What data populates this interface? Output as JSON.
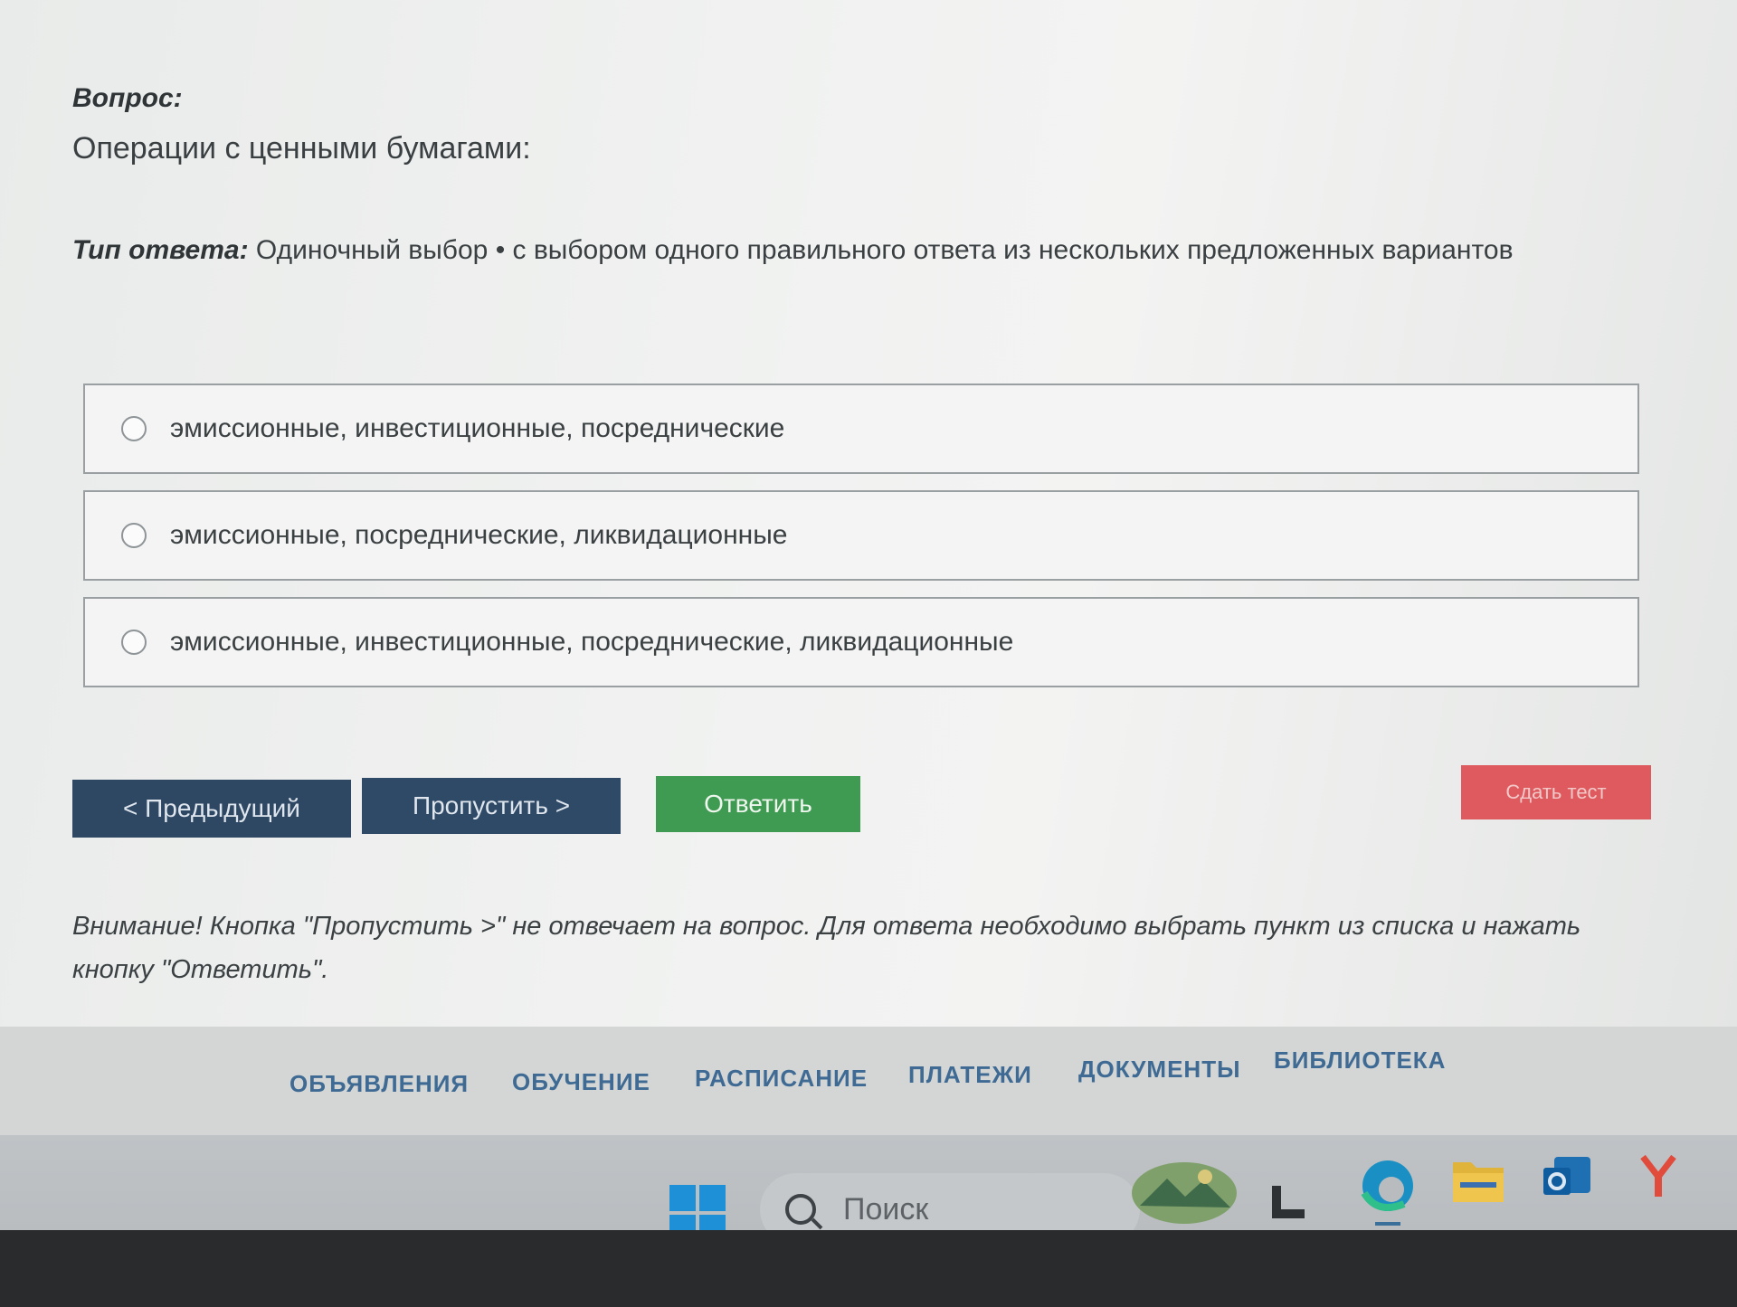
{
  "question": {
    "label": "Вопрос:",
    "text": "Операции с ценными бумагами:"
  },
  "answer_type": {
    "label": "Тип ответа:",
    "value": "Одиночный выбор • с выбором одного правильного ответа из нескольких предложенных вариантов"
  },
  "options": [
    {
      "text": "эмиссионные, инвестиционные, посреднические",
      "selected": false
    },
    {
      "text": "эмиссионные, посреднические, ликвидационные",
      "selected": false
    },
    {
      "text": "эмиссионные, инвестиционные, посреднические, ликвидационные",
      "selected": false
    }
  ],
  "buttons": {
    "prev": "< Предыдущий",
    "skip": "Пропустить >",
    "answer": "Ответить",
    "finish": "Сдать тест"
  },
  "warning": {
    "line1": "Внимание! Кнопка \"Пропустить >\" не отвечает на вопрос. Для ответа необходимо выбрать пункт из списка и нажать",
    "line2": "кнопку \"Ответить\"."
  },
  "footer_nav": [
    "ОБЪЯВЛЕНИЯ",
    "ОБУЧЕНИЕ",
    "РАСПИСАНИЕ",
    "ПЛАТЕЖИ",
    "ДОКУМЕНТЫ",
    "БИБЛИОТЕКА"
  ],
  "taskbar": {
    "search_text": "Поиск",
    "icons": [
      "windows-start-icon",
      "landscape-widget-icon",
      "task-view-icon",
      "edge-icon",
      "file-explorer-icon",
      "outlook-icon",
      "yandex-browser-icon"
    ]
  },
  "colors": {
    "nav_dark_blue": "#2e4763",
    "answer_green": "#3f9a52",
    "finish_red": "#de5a5e",
    "nav_link_blue": "#3e6a94"
  }
}
